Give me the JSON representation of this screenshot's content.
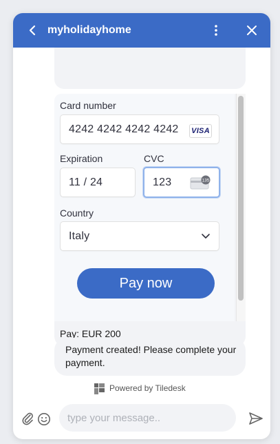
{
  "header": {
    "title": "myholidayhome",
    "back_icon": "chevron-left-icon",
    "menu_icon": "more-vertical-icon",
    "close_icon": "close-icon",
    "color": "#3b6bc6"
  },
  "payment_form": {
    "card_number_label": "Card number",
    "card_number_value": "4242 4242 4242 4242",
    "card_brand": "VISA",
    "expiration_label": "Expiration",
    "expiration_value": "11 / 24",
    "cvc_label": "CVC",
    "cvc_value": "123",
    "cvc_icon_text": "135",
    "country_label": "Country",
    "country_value": "Italy",
    "pay_button_label": "Pay now",
    "amount_text": "Pay: EUR 200"
  },
  "messages": {
    "payment_created": "Payment created! Please complete your payment."
  },
  "branding": {
    "powered_by": "Powered by Tiledesk"
  },
  "footer": {
    "input_placeholder": "type your message..",
    "attach_icon": "paperclip-icon",
    "emoji_icon": "smiley-icon",
    "send_icon": "send-icon"
  }
}
